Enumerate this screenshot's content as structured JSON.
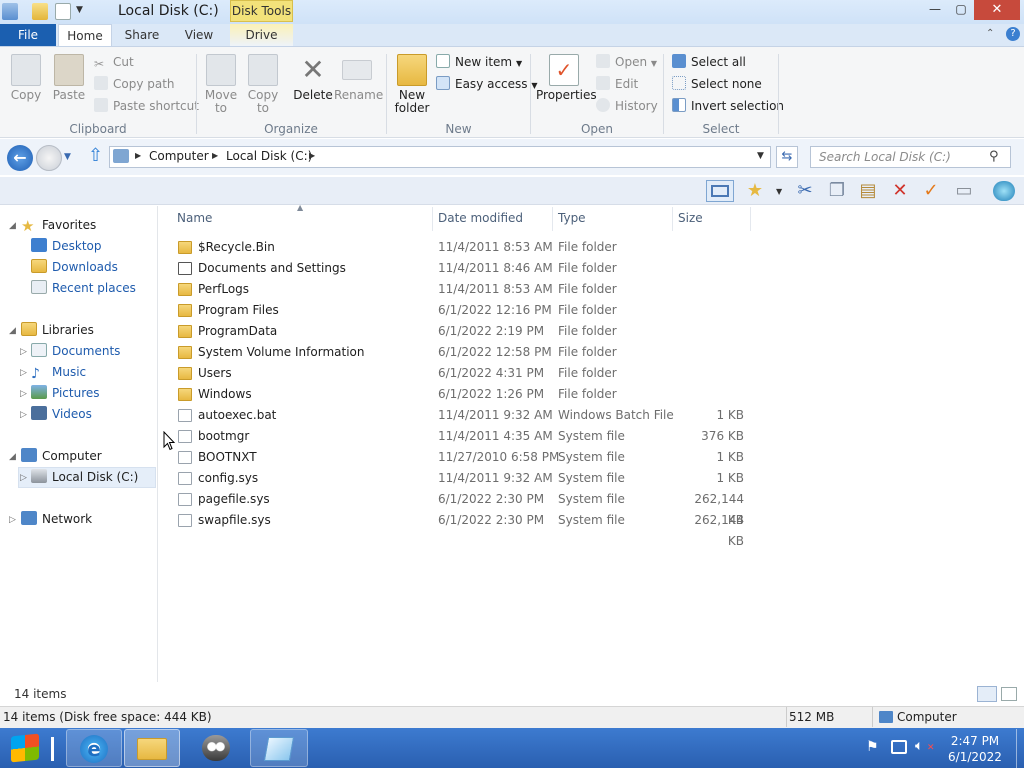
{
  "window": {
    "title": "Local Disk (C:)",
    "context_tab": "Disk Tools",
    "controls": {
      "minimize": "—",
      "maximize": "▢",
      "close": "✕"
    }
  },
  "ribbon": {
    "tabs": {
      "file": "File",
      "home": "Home",
      "share": "Share",
      "view": "View",
      "drive": "Drive"
    },
    "clipboard": {
      "copy": "Copy",
      "paste": "Paste",
      "cut": "Cut",
      "copy_path": "Copy path",
      "paste_shortcut": "Paste shortcut",
      "group": "Clipboard"
    },
    "organize": {
      "move_to_1": "Move",
      "move_to_2": "to",
      "copy_to_1": "Copy",
      "copy_to_2": "to",
      "delete": "Delete",
      "rename": "Rename",
      "group": "Organize"
    },
    "new": {
      "new_folder_1": "New",
      "new_folder_2": "folder",
      "new_item": "New item",
      "easy_access": "Easy access",
      "group": "New"
    },
    "open": {
      "properties": "Properties",
      "open": "Open",
      "edit": "Edit",
      "history": "History",
      "group": "Open"
    },
    "select": {
      "select_all": "Select all",
      "select_none": "Select none",
      "invert": "Invert selection",
      "group": "Select"
    }
  },
  "address": {
    "crumbs": [
      "Computer",
      "Local Disk (C:)"
    ],
    "search_placeholder": "Search Local Disk (C:)"
  },
  "nav": {
    "favorites": "Favorites",
    "desktop": "Desktop",
    "downloads": "Downloads",
    "recent": "Recent places",
    "libraries": "Libraries",
    "documents": "Documents",
    "music": "Music",
    "pictures": "Pictures",
    "videos": "Videos",
    "computer": "Computer",
    "local_disk": "Local Disk (C:)",
    "network": "Network"
  },
  "columns": {
    "name": "Name",
    "date": "Date modified",
    "type": "Type",
    "size": "Size"
  },
  "files": [
    {
      "name": "$Recycle.Bin",
      "date": "11/4/2011 8:53 AM",
      "type": "File folder",
      "size": "",
      "icon": "folder"
    },
    {
      "name": "Documents and Settings",
      "date": "11/4/2011 8:46 AM",
      "type": "File folder",
      "size": "",
      "icon": "shortcut"
    },
    {
      "name": "PerfLogs",
      "date": "11/4/2011 8:53 AM",
      "type": "File folder",
      "size": "",
      "icon": "folder"
    },
    {
      "name": "Program Files",
      "date": "6/1/2022 12:16 PM",
      "type": "File folder",
      "size": "",
      "icon": "folder"
    },
    {
      "name": "ProgramData",
      "date": "6/1/2022 2:19 PM",
      "type": "File folder",
      "size": "",
      "icon": "folder"
    },
    {
      "name": "System Volume Information",
      "date": "6/1/2022 12:58 PM",
      "type": "File folder",
      "size": "",
      "icon": "folder"
    },
    {
      "name": "Users",
      "date": "6/1/2022 4:31 PM",
      "type": "File folder",
      "size": "",
      "icon": "folder"
    },
    {
      "name": "Windows",
      "date": "6/1/2022 1:26 PM",
      "type": "File folder",
      "size": "",
      "icon": "folder"
    },
    {
      "name": "autoexec.bat",
      "date": "11/4/2011 9:32 AM",
      "type": "Windows Batch File",
      "size": "1 KB",
      "icon": "file"
    },
    {
      "name": "bootmgr",
      "date": "11/4/2011 4:35 AM",
      "type": "System file",
      "size": "376 KB",
      "icon": "file"
    },
    {
      "name": "BOOTNXT",
      "date": "11/27/2010 6:58 PM",
      "type": "System file",
      "size": "1 KB",
      "icon": "file"
    },
    {
      "name": "config.sys",
      "date": "11/4/2011 9:32 AM",
      "type": "System file",
      "size": "1 KB",
      "icon": "file"
    },
    {
      "name": "pagefile.sys",
      "date": "6/1/2022 2:30 PM",
      "type": "System file",
      "size": "262,144 KB",
      "icon": "file"
    },
    {
      "name": "swapfile.sys",
      "date": "6/1/2022 2:30 PM",
      "type": "System file",
      "size": "262,144 KB",
      "icon": "file"
    }
  ],
  "status": {
    "count": "14 items",
    "details": "14 items (Disk free space: 444 KB)",
    "memory": "512 MB",
    "location": "Computer"
  },
  "taskbar": {
    "time": "2:47 PM",
    "date": "6/1/2022"
  },
  "colors": {
    "accent": "#1b5fb0",
    "taskbar": "#2f6bc0",
    "folder": "#e7b842",
    "context_tab": "#f3e27a"
  }
}
